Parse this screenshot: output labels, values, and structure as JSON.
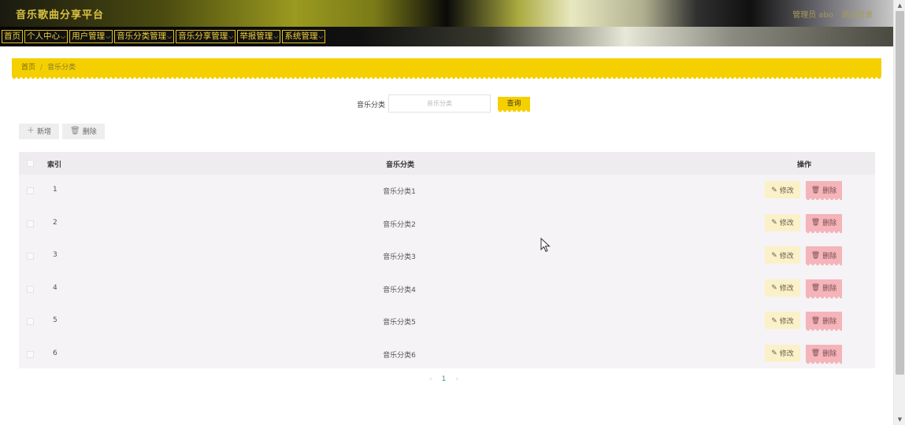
{
  "header": {
    "title": "音乐歌曲分享平台",
    "user_label": "管理员 abo",
    "logout_label": "退出登录"
  },
  "nav": {
    "items": [
      {
        "label": "首页",
        "has_dropdown": false
      },
      {
        "label": "个人中心",
        "has_dropdown": true
      },
      {
        "label": "用户管理",
        "has_dropdown": true
      },
      {
        "label": "音乐分类管理",
        "has_dropdown": true
      },
      {
        "label": "音乐分享管理",
        "has_dropdown": true
      },
      {
        "label": "举报管理",
        "has_dropdown": true
      },
      {
        "label": "系统管理",
        "has_dropdown": true
      }
    ],
    "chevron_icon": "chevron-down-icon"
  },
  "breadcrumb": {
    "home": "首页",
    "separator": "/",
    "current": "音乐分类"
  },
  "search": {
    "label": "音乐分类",
    "placeholder": "音乐分类",
    "button_label": "查询"
  },
  "actions": {
    "add_label": "新增",
    "delete_label": "删除"
  },
  "table": {
    "headers": {
      "index": "索引",
      "category": "音乐分类",
      "action": "操作"
    },
    "rows": [
      {
        "index": "1",
        "category": "音乐分类1"
      },
      {
        "index": "2",
        "category": "音乐分类2"
      },
      {
        "index": "3",
        "category": "音乐分类3"
      },
      {
        "index": "4",
        "category": "音乐分类4"
      },
      {
        "index": "5",
        "category": "音乐分类5"
      },
      {
        "index": "6",
        "category": "音乐分类6"
      }
    ],
    "edit_label": "修改",
    "delete_label": "删除"
  },
  "pagination": {
    "prev": "‹",
    "current_page": "1",
    "next": "›"
  },
  "colors": {
    "accent": "#f5d000",
    "delete": "#f4b4ba",
    "edit": "#fbf1c8",
    "nav_text": "#f0d040"
  }
}
